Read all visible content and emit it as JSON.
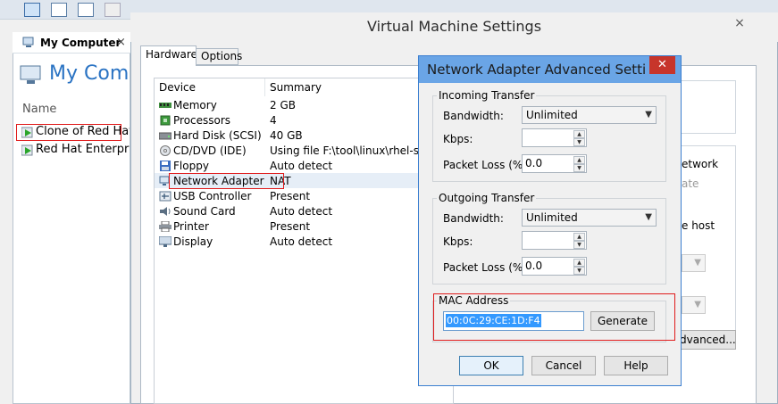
{
  "library": {
    "tab_label": "My Computer",
    "tab_close": "×",
    "heading": "My Computer",
    "column_name": "Name",
    "vms": [
      "Clone of Red Hat",
      "Red Hat Enterprise"
    ]
  },
  "vm_settings": {
    "title": "Virtual Machine Settings",
    "close": "×",
    "tabs": [
      "Hardware",
      "Options"
    ],
    "columns": [
      "Device",
      "Summary"
    ],
    "devices": [
      {
        "name": "Memory",
        "summary": "2 GB"
      },
      {
        "name": "Processors",
        "summary": "4"
      },
      {
        "name": "Hard Disk (SCSI)",
        "summary": "40 GB"
      },
      {
        "name": "CD/DVD (IDE)",
        "summary": "Using file F:\\tool\\linux\\rhel-server."
      },
      {
        "name": "Floppy",
        "summary": "Auto detect"
      },
      {
        "name": "Network Adapter",
        "summary": "NAT"
      },
      {
        "name": "USB Controller",
        "summary": "Present"
      },
      {
        "name": "Sound Card",
        "summary": "Auto detect"
      },
      {
        "name": "Printer",
        "summary": "Present"
      },
      {
        "name": "Display",
        "summary": "Auto detect"
      }
    ],
    "right_partial": {
      "network_text": "etwork",
      "ate_text": "ate",
      "host_text": "e host",
      "advanced_button": "dvanced..."
    }
  },
  "advanced": {
    "title": "Network Adapter Advanced Setti...",
    "close": "✕",
    "incoming": {
      "legend": "Incoming Transfer",
      "bandwidth_label": "Bandwidth:",
      "bandwidth_value": "Unlimited",
      "kbps_label": "Kbps:",
      "kbps_value": "",
      "loss_label": "Packet Loss (%):",
      "loss_value": "0.0"
    },
    "outgoing": {
      "legend": "Outgoing Transfer",
      "bandwidth_label": "Bandwidth:",
      "bandwidth_value": "Unlimited",
      "kbps_label": "Kbps:",
      "kbps_value": "",
      "loss_label": "Packet Loss (%):",
      "loss_value": "0.0"
    },
    "mac": {
      "legend": "MAC Address",
      "value": "00:0C:29:CE:1D:F4",
      "generate_button": "Generate"
    },
    "buttons": {
      "ok": "OK",
      "cancel": "Cancel",
      "help": "Help"
    }
  },
  "colors": {
    "accent": "#2a73c3",
    "highlight": "#e01b1b",
    "title_bar": "#6aa5e6",
    "close_red": "#c7352b"
  }
}
